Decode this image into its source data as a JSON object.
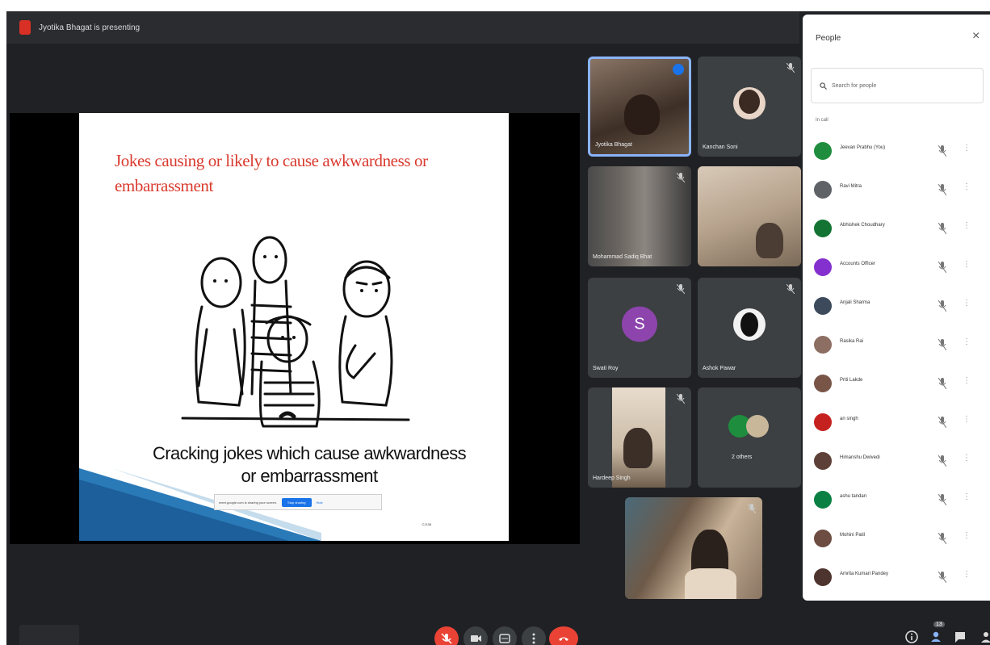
{
  "window": {
    "title": "Jyotika Bhagat is presenting"
  },
  "slide": {
    "heading": "Jokes causing or likely to cause awkwardness or embarrassment",
    "caption": "Cracking jokes which cause awkwardness or embarrassment",
    "share_bar": {
      "text": "meet.google.com is sharing your screen.",
      "stop_label": "Stop sharing",
      "hide_label": "Hide"
    },
    "slide_number": "CJ138"
  },
  "participants": [
    {
      "name": "Jyotika Bhagat",
      "type": "video"
    },
    {
      "name": "Kanchan Soni",
      "type": "photo"
    },
    {
      "name": "Mohammad Sadiq Bhat",
      "type": "video"
    },
    {
      "name": "",
      "type": "video"
    },
    {
      "name": "Swati Roy",
      "type": "initial",
      "initial": "S"
    },
    {
      "name": "Ashok Pawar",
      "type": "photo"
    },
    {
      "name": "Hardeep Singh",
      "type": "video"
    },
    {
      "name": "2 others",
      "type": "group"
    },
    {
      "name": "",
      "type": "video"
    }
  ],
  "people_panel": {
    "title": "People",
    "search_placeholder": "Search for people",
    "section_label": "In call",
    "people": [
      {
        "name": "Jeevan Prabhu (You)",
        "color": "#1e8e3e"
      },
      {
        "name": "Ravi Mitra",
        "color": "#5f6368"
      },
      {
        "name": "Abhishek Choudhary",
        "color": "#137333"
      },
      {
        "name": "Accounts Officer",
        "color": "#8430ce"
      },
      {
        "name": "Anjali Sharma",
        "color": "#3c4a5c"
      },
      {
        "name": "Rasika Rai",
        "color": "#8d6e63"
      },
      {
        "name": "Priti Lakde",
        "color": "#795548"
      },
      {
        "name": "an singh",
        "color": "#c5221f"
      },
      {
        "name": "Himanshu Dwivedi",
        "color": "#5d4037"
      },
      {
        "name": "ashu tandan",
        "color": "#0b8043"
      },
      {
        "name": "Mohini Patil",
        "color": "#6d4c41"
      },
      {
        "name": "Amrita Kumari Pandey",
        "color": "#4e342e"
      }
    ]
  },
  "controls": {
    "people_count": "13"
  }
}
